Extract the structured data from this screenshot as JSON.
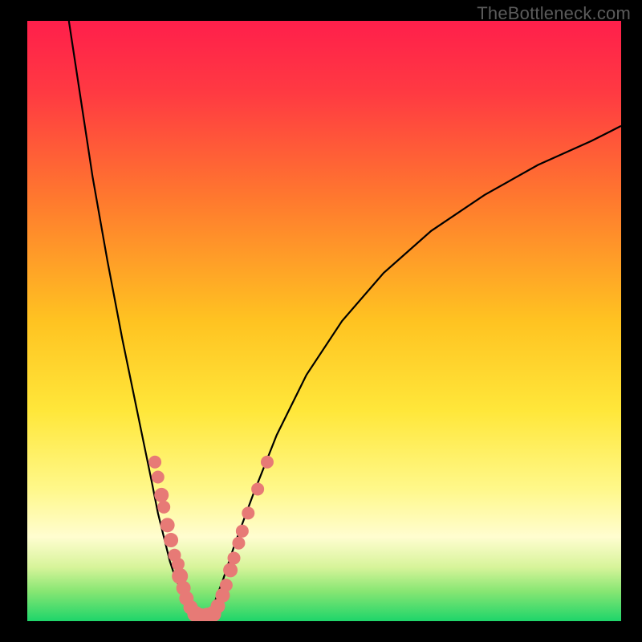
{
  "watermark": "TheBottleneck.com",
  "chart_data": {
    "type": "line",
    "title": "",
    "xlabel": "",
    "ylabel": "",
    "xlim": [
      0,
      100
    ],
    "ylim": [
      0,
      100
    ],
    "gradient_stops": [
      {
        "offset": 0,
        "color": "#ff1f4b"
      },
      {
        "offset": 12,
        "color": "#ff3a42"
      },
      {
        "offset": 30,
        "color": "#ff7a2e"
      },
      {
        "offset": 50,
        "color": "#ffc321"
      },
      {
        "offset": 65,
        "color": "#ffe73a"
      },
      {
        "offset": 78,
        "color": "#fff88a"
      },
      {
        "offset": 86,
        "color": "#fffdd0"
      },
      {
        "offset": 91,
        "color": "#d7f49a"
      },
      {
        "offset": 95,
        "color": "#88e673"
      },
      {
        "offset": 100,
        "color": "#1ed56a"
      }
    ],
    "series": [
      {
        "name": "left-branch",
        "x": [
          7,
          9,
          11,
          13.5,
          16,
          18.5,
          21,
          22,
          23,
          24,
          25,
          26.5,
          28,
          29
        ],
        "y": [
          100,
          87,
          74,
          60,
          47,
          35,
          23,
          18,
          14,
          10,
          7,
          4,
          2,
          0.5
        ]
      },
      {
        "name": "right-branch",
        "x": [
          29,
          30,
          31.5,
          33,
          35,
          38,
          42,
          47,
          53,
          60,
          68,
          77,
          86,
          95,
          100
        ],
        "y": [
          0.5,
          1,
          3,
          7,
          13,
          21,
          31,
          41,
          50,
          58,
          65,
          71,
          76,
          80,
          82.5
        ]
      }
    ],
    "scatter": {
      "name": "markers",
      "color": "#e77a76",
      "points": [
        {
          "x": 21.5,
          "y": 26.5,
          "r": 8
        },
        {
          "x": 22.0,
          "y": 24.0,
          "r": 8
        },
        {
          "x": 22.6,
          "y": 21.0,
          "r": 9
        },
        {
          "x": 23.0,
          "y": 19.0,
          "r": 8
        },
        {
          "x": 23.6,
          "y": 16.0,
          "r": 9
        },
        {
          "x": 24.2,
          "y": 13.5,
          "r": 9
        },
        {
          "x": 24.8,
          "y": 11.0,
          "r": 8
        },
        {
          "x": 25.4,
          "y": 9.5,
          "r": 8
        },
        {
          "x": 25.7,
          "y": 7.5,
          "r": 10
        },
        {
          "x": 26.3,
          "y": 5.5,
          "r": 9
        },
        {
          "x": 26.8,
          "y": 3.8,
          "r": 9
        },
        {
          "x": 27.5,
          "y": 2.3,
          "r": 9
        },
        {
          "x": 28.3,
          "y": 1.2,
          "r": 10
        },
        {
          "x": 29.3,
          "y": 0.8,
          "r": 10
        },
        {
          "x": 30.3,
          "y": 0.9,
          "r": 10
        },
        {
          "x": 31.3,
          "y": 1.2,
          "r": 10
        },
        {
          "x": 32.1,
          "y": 2.5,
          "r": 9
        },
        {
          "x": 32.9,
          "y": 4.3,
          "r": 9
        },
        {
          "x": 33.5,
          "y": 6.0,
          "r": 8
        },
        {
          "x": 34.2,
          "y": 8.5,
          "r": 9
        },
        {
          "x": 34.8,
          "y": 10.5,
          "r": 8
        },
        {
          "x": 35.6,
          "y": 13.0,
          "r": 8
        },
        {
          "x": 36.2,
          "y": 15.0,
          "r": 8
        },
        {
          "x": 37.2,
          "y": 18.0,
          "r": 8
        },
        {
          "x": 38.8,
          "y": 22.0,
          "r": 8
        },
        {
          "x": 40.4,
          "y": 26.5,
          "r": 8
        }
      ]
    }
  }
}
